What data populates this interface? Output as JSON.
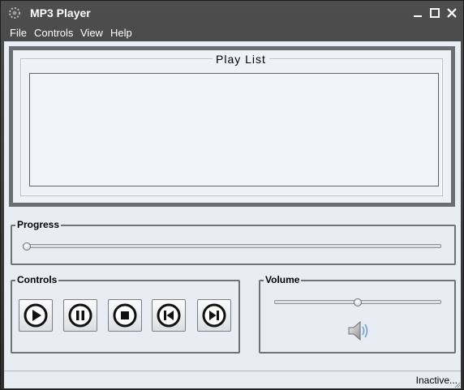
{
  "window": {
    "title": "MP3 Player"
  },
  "menu": {
    "items": [
      "File",
      "Controls",
      "View",
      "Help"
    ]
  },
  "playlist": {
    "title": "Play List"
  },
  "progress": {
    "label": "Progress",
    "value": 0
  },
  "controls": {
    "label": "Controls",
    "buttons": [
      "play",
      "pause",
      "stop",
      "previous",
      "next"
    ]
  },
  "volume": {
    "label": "Volume",
    "value": 0.5
  },
  "status": {
    "text": "Inactive..."
  }
}
